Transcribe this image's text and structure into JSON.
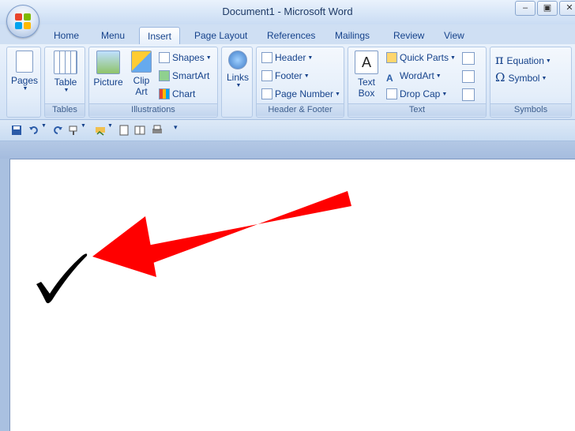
{
  "window": {
    "title": "Document1 - Microsoft Word",
    "controls": [
      "minimize",
      "restore",
      "close"
    ]
  },
  "tabs": [
    {
      "label": "Home"
    },
    {
      "label": "Menu"
    },
    {
      "label": "Insert",
      "active": true
    },
    {
      "label": "Page Layout"
    },
    {
      "label": "References"
    },
    {
      "label": "Mailings"
    },
    {
      "label": "Review"
    },
    {
      "label": "View"
    }
  ],
  "ribbon": {
    "pages": {
      "label": "Pages"
    },
    "tables": {
      "button": "Table",
      "group": "Tables"
    },
    "illustrations": {
      "picture": "Picture",
      "clipart_line1": "Clip",
      "clipart_line2": "Art",
      "shapes": "Shapes",
      "smartart": "SmartArt",
      "chart": "Chart",
      "group": "Illustrations"
    },
    "links": {
      "label": "Links"
    },
    "header_footer": {
      "header": "Header",
      "footer": "Footer",
      "page_number": "Page Number",
      "group": "Header & Footer"
    },
    "text": {
      "textbox_line1": "Text",
      "textbox_line2": "Box",
      "quick_parts": "Quick Parts",
      "wordart": "WordArt",
      "drop_cap": "Drop Cap",
      "group": "Text"
    },
    "symbols": {
      "equation": "Equation",
      "symbol": "Symbol",
      "group": "Symbols"
    }
  },
  "icons": {
    "office_button": "office-logo-icon",
    "checkmark": "checkmark-icon",
    "arrow": "red-arrow-icon"
  },
  "colors": {
    "annotation_arrow": "#ff0000",
    "checkmark": "#000000",
    "ribbon_text": "#15428b"
  }
}
